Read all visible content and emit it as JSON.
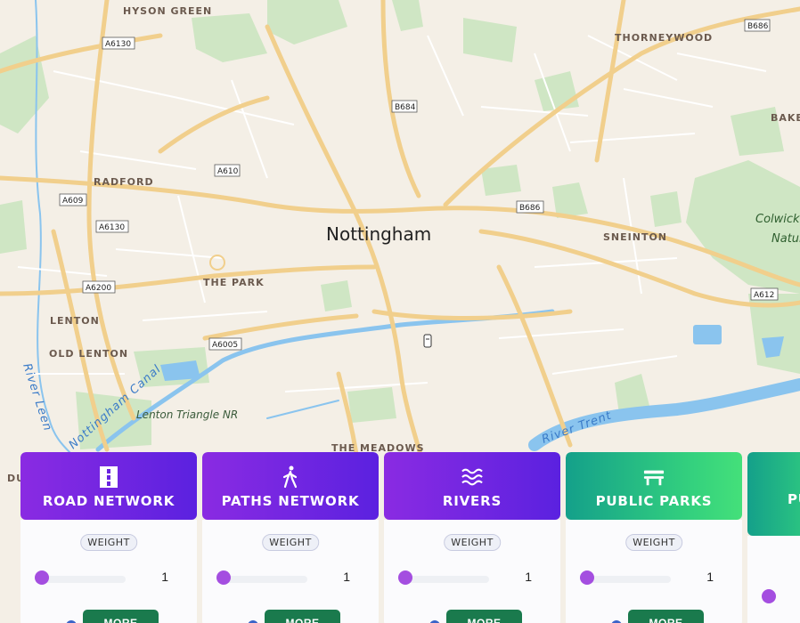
{
  "map": {
    "city_label": "Nottingham",
    "places": [
      "HYSON GREEN",
      "THORNEYWOOD",
      "BAKER",
      "RADFORD",
      "SNEINTON",
      "THE PARK",
      "LENTON",
      "OLD LENTON",
      "THE MEADOWS",
      "DU"
    ],
    "parks": [
      "Lenton Triangle NR",
      "Colwick",
      "Natur"
    ],
    "water": [
      "River Leen",
      "Nottingham Canal",
      "River Trent"
    ],
    "roads": [
      "A6130",
      "B684",
      "B686",
      "A610",
      "A609",
      "A6130",
      "B686",
      "A6200",
      "A612",
      "A6005"
    ],
    "colors": {
      "land": "#f4efe6",
      "road": "#f1cf8c",
      "park": "#cfe6c4",
      "water": "#8ac4ee"
    }
  },
  "cards": [
    {
      "title": "ROAD NETWORK",
      "icon": "road-icon",
      "weight_label": "WEIGHT",
      "weight_value": "1",
      "more_label": "MORE",
      "theme": "purple"
    },
    {
      "title": "PATHS NETWORK",
      "icon": "walking-icon",
      "weight_label": "WEIGHT",
      "weight_value": "1",
      "more_label": "MORE",
      "theme": "purple"
    },
    {
      "title": "RIVERS",
      "icon": "water-waves-icon",
      "weight_label": "WEIGHT",
      "weight_value": "1",
      "more_label": "MORE",
      "theme": "purple"
    },
    {
      "title": "PUBLIC PARKS",
      "icon": "bench-icon",
      "weight_label": "WEIGHT",
      "weight_value": "1",
      "more_label": "MORE",
      "theme": "green"
    },
    {
      "title": "PU",
      "theme": "green"
    }
  ]
}
